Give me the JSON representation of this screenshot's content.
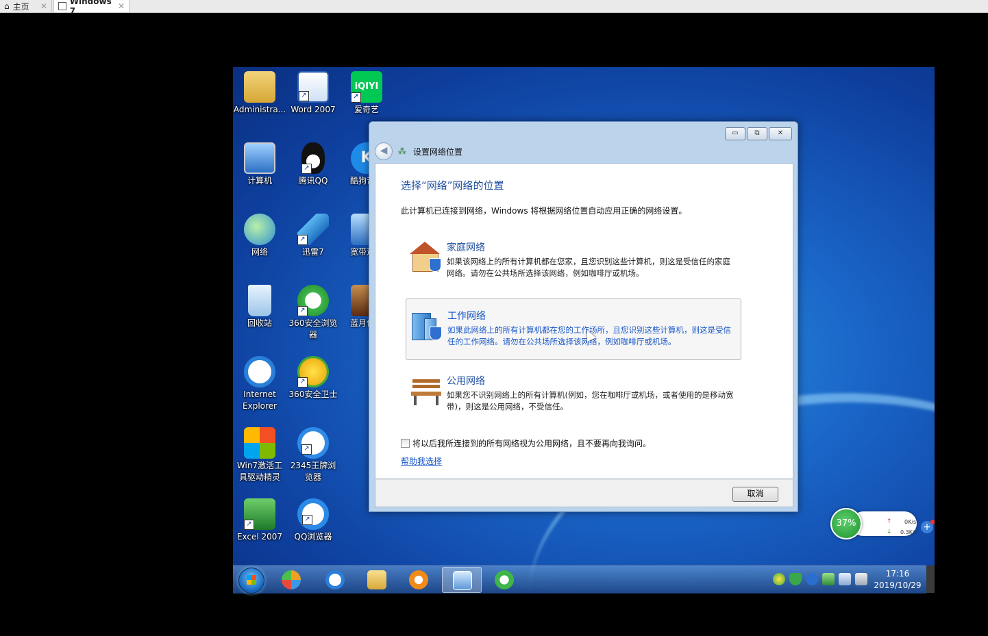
{
  "host_tabs": {
    "home_label": "主页",
    "vm_label": "Windows 7",
    "close_glyph": "✕"
  },
  "desktop_icons": [
    {
      "label": "Administra...",
      "icon": "user-folder-icon"
    },
    {
      "label": "Word 2007",
      "icon": "word-icon"
    },
    {
      "label": "爱奇艺",
      "icon": "iqiyi-icon",
      "logo_text": "iQIYI"
    },
    {
      "label": "计算机",
      "icon": "computer-icon"
    },
    {
      "label": "腾讯QQ",
      "icon": "qq-penguin-icon"
    },
    {
      "label": "酷狗音乐",
      "icon": "kugou-icon",
      "logo_text": "K"
    },
    {
      "label": "网络",
      "icon": "network-globe-icon"
    },
    {
      "label": "迅雷7",
      "icon": "xunlei-bird-icon"
    },
    {
      "label": "宽带连接",
      "icon": "broadband-icon"
    },
    {
      "label": "回收站",
      "icon": "recycle-bin-icon"
    },
    {
      "label": "360安全浏览器",
      "icon": "360-browser-icon"
    },
    {
      "label": "蓝月传奇",
      "icon": "game-warrior-icon"
    },
    {
      "label": "Internet Explorer",
      "icon": "ie-icon"
    },
    {
      "label": "360安全卫士",
      "icon": "360-guard-icon"
    },
    {
      "label": "Win7激活工具驱动精灵",
      "icon": "win7-activator-icon"
    },
    {
      "label": "2345王牌浏览器",
      "icon": "2345-browser-icon"
    },
    {
      "label": "Excel 2007",
      "icon": "excel-icon"
    },
    {
      "label": "QQ浏览器",
      "icon": "qq-browser-icon"
    }
  ],
  "dialog": {
    "title": "设置网络位置",
    "window_buttons": {
      "minimize": "▭",
      "restore": "⧉",
      "close": "✕"
    },
    "back_glyph": "◀",
    "heading": "选择“网络”网络的位置",
    "description": "此计算机已连接到网络，Windows 将根据网络位置自动应用正确的网络设置。",
    "options": [
      {
        "title": "家庭网络",
        "text": "如果该网络上的所有计算机都在您家，且您识别这些计算机，则这是受信任的家庭网络。请勿在公共场所选择该网络，例如咖啡厅或机场。",
        "icon": "home-network-icon"
      },
      {
        "title": "工作网络",
        "text": "如果此网络上的所有计算机都在您的工作场所，且您识别这些计算机，则这是受信任的工作网络。请勿在公共场所选择该网络，例如咖啡厅或机场。",
        "icon": "work-network-icon"
      },
      {
        "title": "公用网络",
        "text": "如果您不识别网络上的所有计算机(例如，您在咖啡厅或机场，或者使用的是移动宽带)，则这是公用网络，不受信任。",
        "icon": "public-bench-icon"
      }
    ],
    "checkbox_label": "将以后我所连接到的所有网络视为公用网络，且不要再向我询问。",
    "checkbox_checked": false,
    "help_link": "帮助我选择",
    "cancel_button": "取消"
  },
  "float_widget": {
    "percent": "37%",
    "upload": "0K/s",
    "download": "0.3K/s",
    "plus": "+"
  },
  "taskbar": {
    "items": [
      {
        "icon": "msn-butterfly-icon"
      },
      {
        "icon": "ie-taskbar-icon"
      },
      {
        "icon": "explorer-folder-icon"
      },
      {
        "icon": "media-player-icon"
      },
      {
        "icon": "network-settings-icon",
        "active": true
      },
      {
        "icon": "360-browser-taskbar-icon"
      }
    ],
    "tray": [
      "360-plus-icon",
      "shield-icon",
      "bluetooth-icon",
      "network-check-icon",
      "network-monitor-icon",
      "volume-icon"
    ],
    "time": "17:16",
    "date": "2019/10/29"
  },
  "colors": {
    "dialog_heading": "#1f4fa0",
    "link": "#1756c8",
    "desktop": "#1a66c8",
    "widget_green": "#1f8f2f"
  }
}
